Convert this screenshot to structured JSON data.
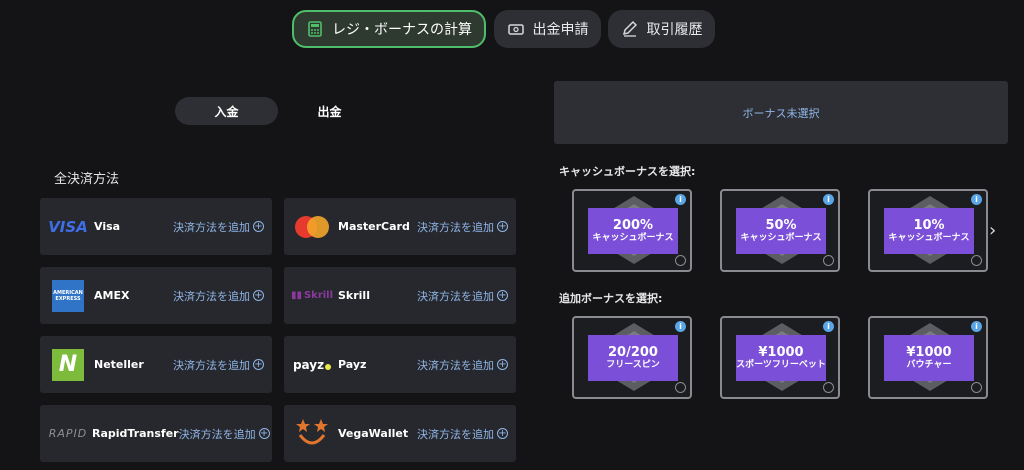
{
  "top_tabs": [
    {
      "label": "レジ・ボーナスの計算",
      "icon": "calculator-icon",
      "active": true
    },
    {
      "label": "出金申請",
      "icon": "cash-icon",
      "active": false
    },
    {
      "label": "取引履歴",
      "icon": "pencil-icon",
      "active": false
    }
  ],
  "toggle": {
    "deposit": "入金",
    "withdraw": "出金"
  },
  "methods": {
    "title": "全決済方法",
    "add_label": "決済方法を追加",
    "items": [
      {
        "name": "Visa",
        "logo_text": "VISA"
      },
      {
        "name": "MasterCard",
        "logo_text": ""
      },
      {
        "name": "AMEX",
        "logo_text": "AMERICAN EXPRESS"
      },
      {
        "name": "Skrill",
        "logo_text": "Skrill"
      },
      {
        "name": "Neteller",
        "logo_text": "N"
      },
      {
        "name": "Payz",
        "logo_text": "payz"
      },
      {
        "name": "RapidTransfer",
        "logo_text": "RAPID"
      },
      {
        "name": "VegaWallet",
        "logo_text": ""
      }
    ]
  },
  "bonus": {
    "status": "ボーナス未選択",
    "cash_title": "キャッシュボーナスを選択:",
    "extra_title": "追加ボーナスを選択:",
    "cash": [
      {
        "big": "200%",
        "small": "キャッシュボーナス"
      },
      {
        "big": "50%",
        "small": "キャッシュボーナス"
      },
      {
        "big": "10%",
        "small": "キャッシュボーナス"
      }
    ],
    "extra": [
      {
        "big": "20/200",
        "small": "フリースピン"
      },
      {
        "big": "¥1000",
        "small": "スポーツフリーベット"
      },
      {
        "big": "¥1000",
        "small": "バウチャー"
      }
    ],
    "info_glyph": "i",
    "next_glyph": "›"
  },
  "colors": {
    "accent_green": "#4fbe6a",
    "bonus_purple": "#7b4fd8",
    "link_blue": "#8fb6e8"
  }
}
